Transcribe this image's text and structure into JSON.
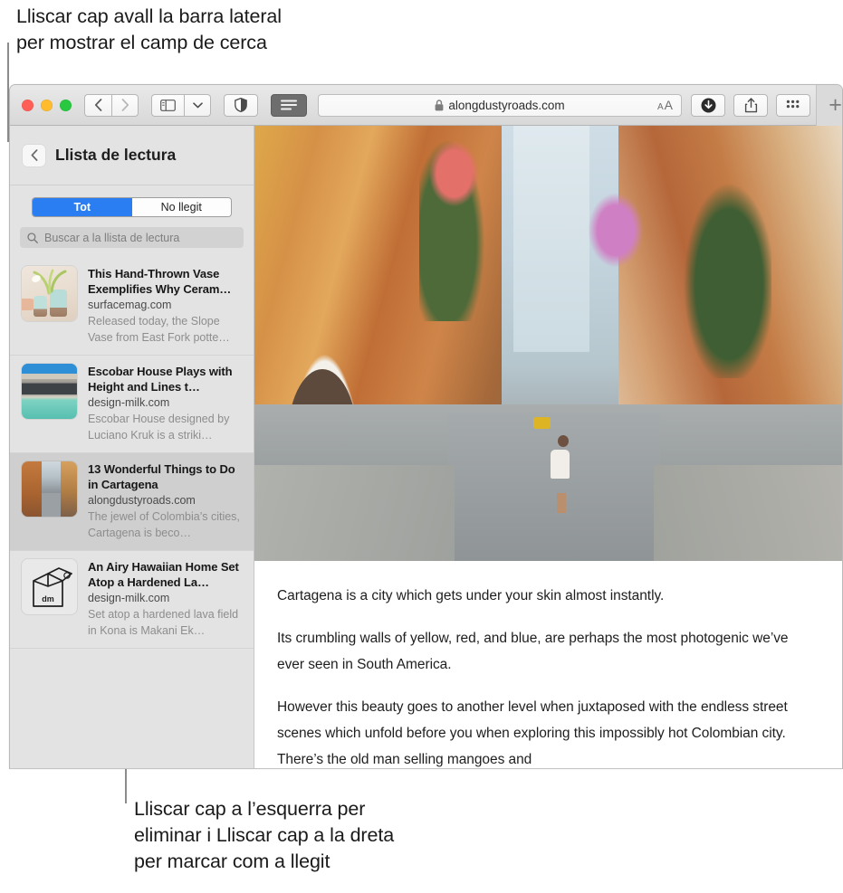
{
  "callouts": {
    "top": "Lliscar cap avall la barra lateral\nper mostrar el camp de cerca",
    "bottom": "Lliscar cap a l’esquerra per\neliminar i Lliscar cap a la dreta\nper marcar com a llegit"
  },
  "toolbar": {
    "back_icon": "chevron-left-icon",
    "forward_icon": "chevron-right-icon",
    "sidebar_icon": "sidebar-icon",
    "sidebar_menu_icon": "chevron-down-icon",
    "privacy_icon": "shield-icon",
    "reader_icon": "reader-view-icon",
    "lock_icon": "lock-icon",
    "url": "alongdustyroads.com",
    "text_size_small": "A",
    "text_size_large": "A",
    "downloads_icon": "download-icon",
    "share_icon": "share-icon",
    "tab_overview_icon": "tab-overview-icon",
    "new_tab_label": "+"
  },
  "sidebar": {
    "back_icon": "chevron-left-icon",
    "title": "Llista de lectura",
    "segmented": {
      "all_label": "Tot",
      "unread_label": "No llegit",
      "selected": "Tot",
      "accent_color": "#2b7ef2"
    },
    "search": {
      "icon": "search-icon",
      "placeholder": "Buscar a la llista de lectura",
      "value": ""
    },
    "items": [
      {
        "title": "This Hand-Thrown Vase Exemplifies Why Ceram…",
        "site": "surfacemag.com",
        "desc": "Released today, the Slope Vase from East Fork potte…",
        "thumb": "vase-thumbnail",
        "selected": false
      },
      {
        "title": "Escobar House Plays with Height and Lines t…",
        "site": "design-milk.com",
        "desc": "Escobar House designed by Luciano Kruk is a striki…",
        "thumb": "house-thumbnail",
        "selected": false
      },
      {
        "title": "13 Wonderful Things to Do in Cartagena",
        "site": "alongdustyroads.com",
        "desc": "The jewel of Colombia’s cities, Cartagena is beco…",
        "thumb": "street-thumbnail",
        "selected": true
      },
      {
        "title": "An Airy Hawaiian Home Set Atop a Hardened La…",
        "site": "design-milk.com",
        "desc": "Set atop a hardened lava field in Kona is Makani Ek…",
        "thumb": "design-milk-logo-thumbnail",
        "selected": false
      }
    ]
  },
  "article": {
    "hero_image": "cartagena-street-photo",
    "paragraphs": [
      "Cartagena is a city which gets under your skin almost instantly.",
      "Its crumbling walls of yellow, red, and blue, are perhaps the most photogenic we’ve ever seen in South America.",
      "However this beauty goes to another level when juxtaposed with the endless street scenes which unfold before you when exploring this impossibly hot Colombian city. There’s the old man selling mangoes and"
    ]
  }
}
